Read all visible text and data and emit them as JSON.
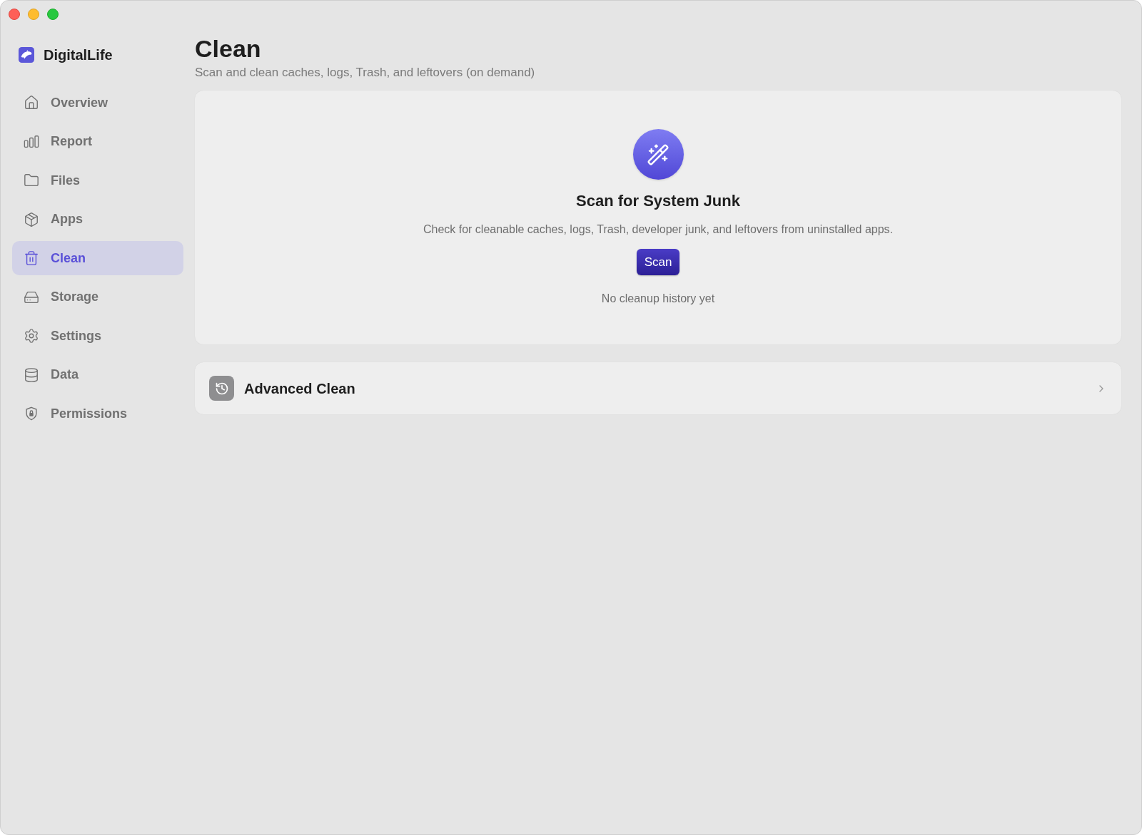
{
  "sidebar": {
    "app_name": "DigitalLife",
    "items": [
      {
        "label": "Overview",
        "selected": false
      },
      {
        "label": "Report",
        "selected": false
      },
      {
        "label": "Files",
        "selected": false
      },
      {
        "label": "Apps",
        "selected": false
      },
      {
        "label": "Clean",
        "selected": true
      },
      {
        "label": "Storage",
        "selected": false
      },
      {
        "label": "Settings",
        "selected": false
      },
      {
        "label": "Data",
        "selected": false
      },
      {
        "label": "Permissions",
        "selected": false
      }
    ]
  },
  "header": {
    "title": "Clean",
    "subtitle": "Scan and clean caches, logs, Trash, and leftovers (on demand)"
  },
  "scan_card": {
    "title": "Scan for System Junk",
    "description": "Check for cleanable caches, logs, Trash, developer junk, and leftovers from uninstalled apps.",
    "button": "Scan",
    "history": "No cleanup history yet"
  },
  "advanced_row": {
    "label": "Advanced Clean"
  }
}
